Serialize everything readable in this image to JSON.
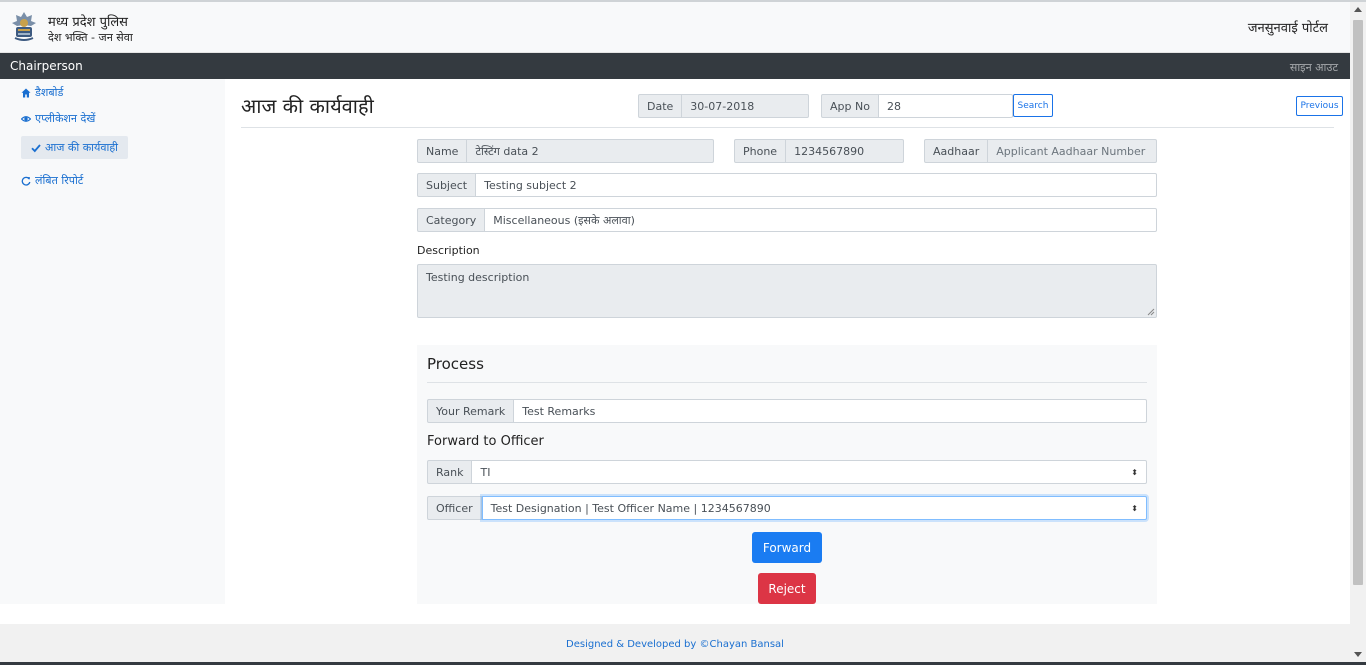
{
  "header": {
    "brand_title": "मध्य प्रदेश पुलिस",
    "brand_subtitle": "देश भक्ति - जन सेवा",
    "portal_title": "जनसुनवाई पोर्टल"
  },
  "navbar": {
    "role": "Chairperson",
    "signout": "साइन आउट"
  },
  "sidebar": {
    "items": [
      {
        "label": "डैशबोर्ड",
        "icon": "home-icon"
      },
      {
        "label": "एप्लीकेशन देखें",
        "icon": "eye-icon"
      },
      {
        "label": "आज की कार्यवाही",
        "icon": "check-icon",
        "active": true
      },
      {
        "label": "लंबित रिपोर्ट",
        "icon": "refresh-icon"
      }
    ]
  },
  "page": {
    "title": "आज की कार्यवाही",
    "date_label": "Date",
    "date_value": "30-07-2018",
    "appno_label": "App No",
    "appno_value": "28",
    "search_label": "Search",
    "previous_label": "Previous"
  },
  "form": {
    "name_label": "Name",
    "name_value": "टेस्टिंग data 2",
    "phone_label": "Phone",
    "phone_value": "1234567890",
    "aadhaar_label": "Aadhaar",
    "aadhaar_placeholder": "Applicant Aadhaar Number",
    "subject_label": "Subject",
    "subject_value": "Testing subject 2",
    "category_label": "Category",
    "category_value": "Miscellaneous (इसके अलावा)",
    "description_label": "Description",
    "description_value": "Testing description"
  },
  "process": {
    "title": "Process",
    "remark_label": "Your Remark",
    "remark_value": "Test Remarks",
    "forward_title": "Forward to Officer",
    "rank_label": "Rank",
    "rank_value": "TI",
    "officer_label": "Officer",
    "officer_value": "Test Designation | Test Officer Name | 1234567890",
    "forward_button": "Forward",
    "reject_button": "Reject"
  },
  "footer": {
    "credit": "Designed & Developed by ©Chayan Bansal"
  },
  "colors": {
    "primary": "#1a7cf2",
    "danger": "#dc3545",
    "navbar": "#343a40",
    "link": "#1a6fd0"
  }
}
